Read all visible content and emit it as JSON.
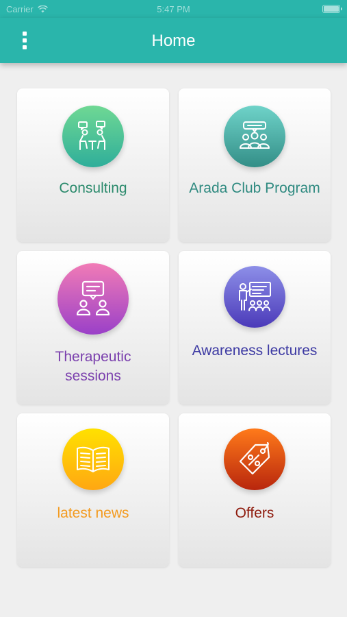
{
  "status_bar": {
    "carrier": "Carrier",
    "time": "5:47 PM"
  },
  "nav": {
    "title": "Home"
  },
  "cards": [
    {
      "label": "Consulting",
      "icon": "consulting-icon"
    },
    {
      "label": "Arada Club Program",
      "icon": "club-program-icon"
    },
    {
      "label_line1": "Therapeutic",
      "label_line2": "sessions",
      "icon": "therapeutic-sessions-icon"
    },
    {
      "label": "Awareness lectures",
      "icon": "lecture-icon"
    },
    {
      "label": "latest news",
      "icon": "news-icon"
    },
    {
      "label": "Offers",
      "icon": "offers-icon"
    }
  ],
  "colors": {
    "accent": "#2ab5ab",
    "background": "#efefef"
  }
}
